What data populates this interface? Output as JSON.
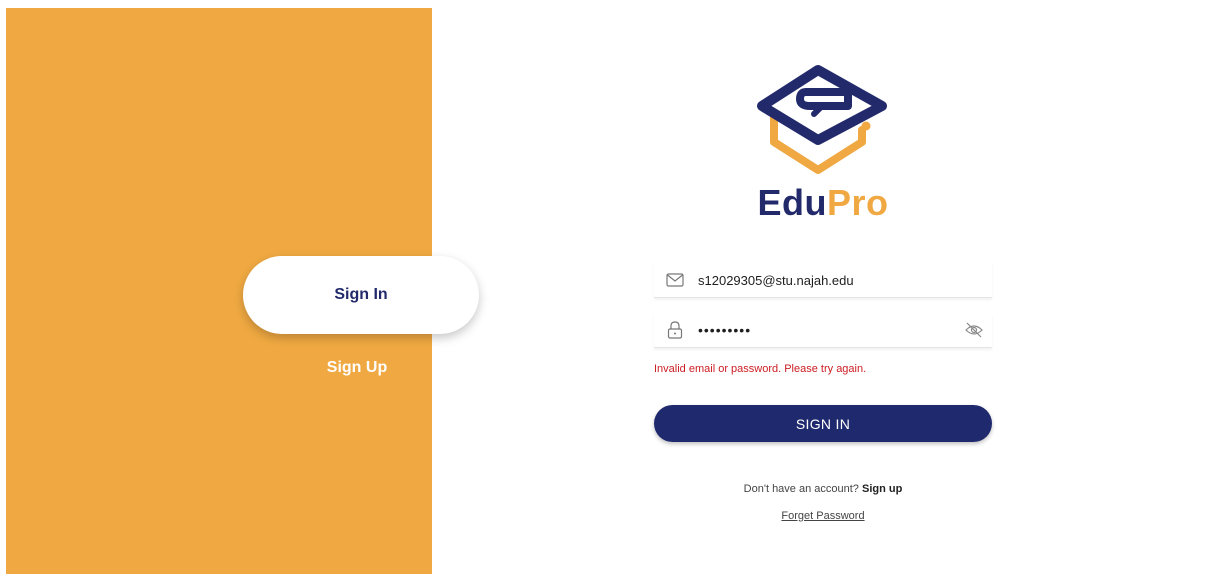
{
  "side_panel": {
    "sign_in_tab": "Sign In",
    "sign_up_tab": "Sign Up",
    "background_color": "#f0a942"
  },
  "logo": {
    "text_part1": "Edu",
    "text_part2": "Pro",
    "primary_color": "#222a6b",
    "accent_color": "#f0a942"
  },
  "form": {
    "email": {
      "value": "s12029305@stu.najah.edu",
      "icon": "envelope-icon"
    },
    "password": {
      "value": "•••••••••",
      "icon": "lock-icon",
      "toggle_icon": "eye-slash-icon"
    },
    "error_message": "Invalid email or password. Please try again.",
    "submit_label": "SIGN IN",
    "no_account_text": "Don't have an account?",
    "sign_up_link": "Sign up",
    "forget_password_link": "Forget Password"
  }
}
